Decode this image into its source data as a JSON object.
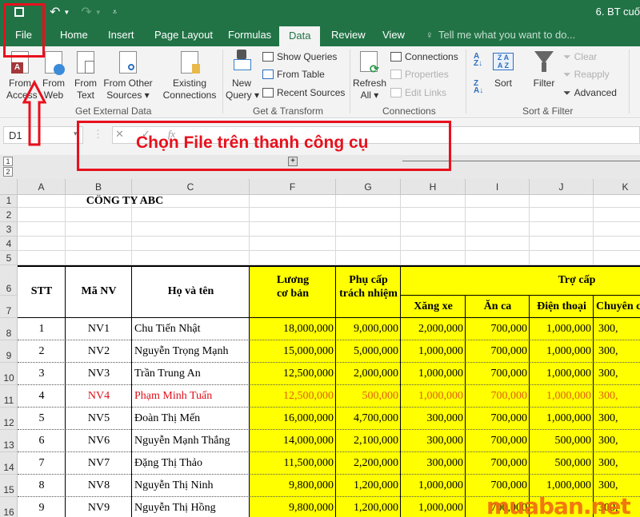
{
  "window": {
    "title": "6. BT cuố",
    "qat": {
      "save_icon": "save-icon",
      "undo_icon": "undo-icon",
      "redo_icon": "redo-icon",
      "customize_icon": "customize-icon"
    }
  },
  "tabs": [
    {
      "label": "File",
      "active": false
    },
    {
      "label": "Home",
      "active": false
    },
    {
      "label": "Insert",
      "active": false
    },
    {
      "label": "Page Layout",
      "active": false
    },
    {
      "label": "Formulas",
      "active": false
    },
    {
      "label": "Data",
      "active": true
    },
    {
      "label": "Review",
      "active": false
    },
    {
      "label": "View",
      "active": false
    }
  ],
  "tell_me": "Tell me what you want to do...",
  "ribbon": {
    "get_external_data": {
      "label": "Get External Data",
      "buttons": [
        {
          "line1": "From",
          "line2": "Access"
        },
        {
          "line1": "From",
          "line2": "Web"
        },
        {
          "line1": "From",
          "line2": "Text"
        },
        {
          "line1": "From Other",
          "line2": "Sources ▾"
        },
        {
          "line1": "Existing",
          "line2": "Connections"
        }
      ]
    },
    "get_transform": {
      "label": "Get & Transform",
      "new_query": {
        "line1": "New",
        "line2": "Query ▾"
      },
      "items": [
        "Show Queries",
        "From Table",
        "Recent Sources"
      ]
    },
    "connections": {
      "label": "Connections",
      "refresh_all": {
        "line1": "Refresh",
        "line2": "All ▾"
      },
      "items": [
        {
          "label": "Connections",
          "disabled": false
        },
        {
          "label": "Properties",
          "disabled": true
        },
        {
          "label": "Edit Links",
          "disabled": true
        }
      ]
    },
    "sort_filter": {
      "label": "Sort & Filter",
      "sort": "Sort",
      "filter": "Filter",
      "items": [
        {
          "label": "Clear",
          "disabled": true
        },
        {
          "label": "Reapply",
          "disabled": true
        },
        {
          "label": "Advanced",
          "disabled": false
        }
      ]
    }
  },
  "formula_bar": {
    "name_box": "D1",
    "fx": "fx",
    "value": ""
  },
  "outline": {
    "levels": [
      "1",
      "2"
    ]
  },
  "columns": [
    "A",
    "B",
    "C",
    "F",
    "G",
    "H",
    "I",
    "J",
    "K"
  ],
  "row_numbers": [
    "1",
    "2",
    "3",
    "4",
    "5",
    "6",
    "7",
    "8",
    "9",
    "10",
    "11",
    "12",
    "13",
    "14",
    "15",
    "16"
  ],
  "sheet": {
    "company": "CÔNG TY ABC",
    "headers": {
      "stt": "STT",
      "ma_nv": "Mã NV",
      "ho_ten": "Họ và tên",
      "luong_1": "Lương",
      "luong_2": "cơ bản",
      "phu_cap_1": "Phụ cấp",
      "phu_cap_2": "trách nhiệm",
      "tro_cap": "Trợ cấp",
      "xang_xe": "Xăng xe",
      "an_ca": "Ăn ca",
      "dien_thoai": "Điện thoại",
      "chuyen": "Chuyên c"
    },
    "rows": [
      {
        "stt": "1",
        "ma": "NV1",
        "ten": "Chu Tiến Nhật",
        "luong": "18,000,000",
        "pc": "9,000,000",
        "xx": "2,000,000",
        "ac": "700,000",
        "dt": "1,000,000",
        "cc": "300,",
        "highlight": false
      },
      {
        "stt": "2",
        "ma": "NV2",
        "ten": "Nguyễn Trọng Mạnh",
        "luong": "15,000,000",
        "pc": "5,000,000",
        "xx": "1,000,000",
        "ac": "700,000",
        "dt": "1,000,000",
        "cc": "300,",
        "highlight": false
      },
      {
        "stt": "3",
        "ma": "NV3",
        "ten": "Trần Trung An",
        "luong": "12,500,000",
        "pc": "2,000,000",
        "xx": "1,000,000",
        "ac": "700,000",
        "dt": "1,000,000",
        "cc": "300,",
        "highlight": false
      },
      {
        "stt": "4",
        "ma": "NV4",
        "ten": "Phạm Minh Tuấn",
        "luong": "12,500,000",
        "pc": "500,000",
        "xx": "1,000,000",
        "ac": "700,000",
        "dt": "1,000,000",
        "cc": "300,",
        "highlight": true
      },
      {
        "stt": "5",
        "ma": "NV5",
        "ten": "Đoàn Thị Mến",
        "luong": "16,000,000",
        "pc": "4,700,000",
        "xx": "300,000",
        "ac": "700,000",
        "dt": "1,000,000",
        "cc": "300,",
        "highlight": false
      },
      {
        "stt": "6",
        "ma": "NV6",
        "ten": "Nguyễn Mạnh Thắng",
        "luong": "14,000,000",
        "pc": "2,100,000",
        "xx": "300,000",
        "ac": "700,000",
        "dt": "500,000",
        "cc": "300,",
        "highlight": false
      },
      {
        "stt": "7",
        "ma": "NV7",
        "ten": "Đặng Thị Thảo",
        "luong": "11,500,000",
        "pc": "2,200,000",
        "xx": "300,000",
        "ac": "700,000",
        "dt": "500,000",
        "cc": "300,",
        "highlight": false
      },
      {
        "stt": "8",
        "ma": "NV8",
        "ten": "Nguyễn Thị Ninh",
        "luong": "9,800,000",
        "pc": "1,200,000",
        "xx": "1,000,000",
        "ac": "700,000",
        "dt": "1,000,000",
        "cc": "300,",
        "highlight": false
      },
      {
        "stt": "9",
        "ma": "NV9",
        "ten": "Nguyễn Thị Hồng",
        "luong": "9,800,000",
        "pc": "1,200,000",
        "xx": "1,000,000",
        "ac": "700,000",
        "dt": "",
        "cc": "300,",
        "highlight": false
      }
    ]
  },
  "annotation": {
    "text": "Chọn File trên thanh công cụ",
    "color": "#e8101d"
  },
  "watermark": "muaban.net",
  "colors": {
    "excel_green": "#217346",
    "cell_yellow": "#ffff00",
    "highlight_red": "#e0101a"
  }
}
